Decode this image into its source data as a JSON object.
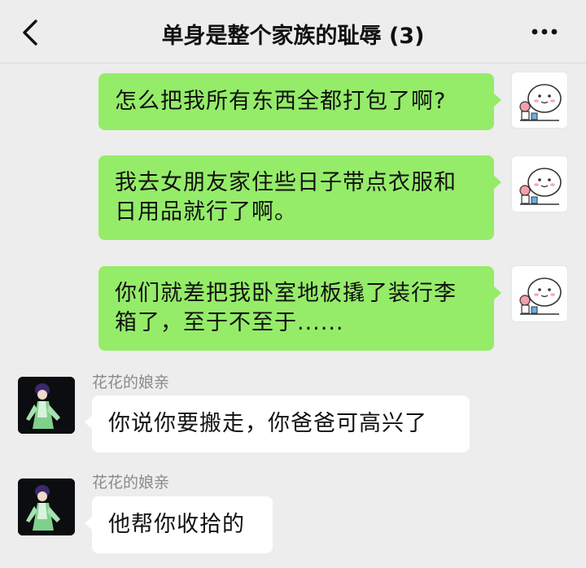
{
  "header": {
    "title": "单身是整个家族的耻辱 (3)",
    "back_icon": "chevron-left-icon",
    "more_icon": "more-dots-icon"
  },
  "messages": [
    {
      "direction": "sent",
      "text": "怎么把我所有东西全都打包了啊?"
    },
    {
      "direction": "sent",
      "text_line1": "我去女朋友家住些日子带点衣服和",
      "text_line2": "日用品就行了啊。"
    },
    {
      "direction": "sent",
      "text_line1": "你们就差把我卧室地板撬了装行李",
      "text_line2": "箱了，至于不至于......"
    },
    {
      "direction": "received",
      "sender": "花花的娘亲",
      "text": "你说你要搬走，你爸爸可高兴了"
    },
    {
      "direction": "received",
      "sender": "花花的娘亲",
      "text": "他帮你收拾的"
    }
  ],
  "colors": {
    "sent_bubble": "#95ec69",
    "received_bubble": "#ffffff",
    "background": "#ededed"
  }
}
